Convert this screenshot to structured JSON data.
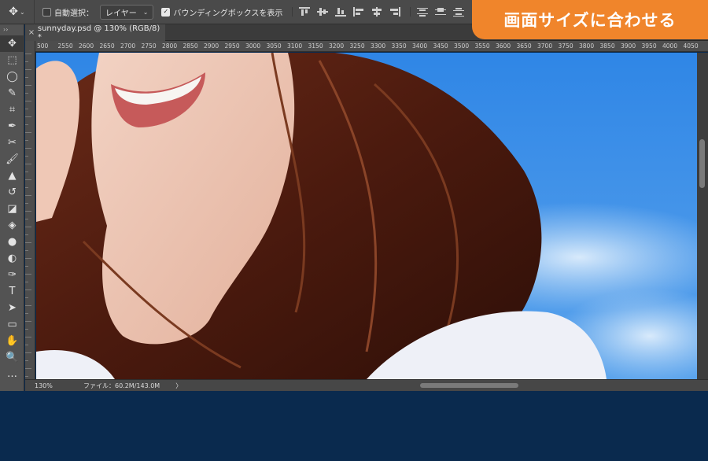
{
  "options_bar": {
    "auto_select_label": "自動選択：",
    "auto_select_value": "レイヤー",
    "bounding_box_label": "バウンディングボックスを表示"
  },
  "badge": {
    "text": "画面サイズに合わせる",
    "color": "#f0852b"
  },
  "document": {
    "tab_title": "sunnyday.psd @ 130% (RGB/8) *",
    "close_glyph": "×"
  },
  "ruler": {
    "top_marks": [
      "500",
      "2550",
      "2600",
      "2650",
      "2700",
      "2750",
      "2800",
      "2850",
      "2900",
      "2950",
      "3000",
      "3050",
      "3100",
      "3150",
      "3200",
      "3250",
      "3300",
      "3350",
      "3400",
      "3450",
      "3500",
      "3550",
      "3600",
      "3650",
      "3700",
      "3750",
      "3800",
      "3850",
      "3900",
      "3950",
      "4000",
      "4050"
    ]
  },
  "status_bar": {
    "zoom": "130%",
    "file_info": "ファイル：60.2M/143.0M",
    "arrow": "〉"
  },
  "tools": [
    {
      "name": "move-tool-icon",
      "glyph": "✥"
    },
    {
      "name": "marquee-tool-icon",
      "glyph": "⬚"
    },
    {
      "name": "lasso-tool-icon",
      "glyph": "◯"
    },
    {
      "name": "quick-select-tool-icon",
      "glyph": "✎"
    },
    {
      "name": "crop-tool-icon",
      "glyph": "⌗"
    },
    {
      "name": "eyedropper-tool-icon",
      "glyph": "✒"
    },
    {
      "name": "healing-brush-tool-icon",
      "glyph": "✂"
    },
    {
      "name": "brush-tool-icon",
      "glyph": "🖌"
    },
    {
      "name": "clone-stamp-tool-icon",
      "glyph": "▲"
    },
    {
      "name": "history-brush-tool-icon",
      "glyph": "↺"
    },
    {
      "name": "eraser-tool-icon",
      "glyph": "◪"
    },
    {
      "name": "paint-bucket-tool-icon",
      "glyph": "◈"
    },
    {
      "name": "blur-tool-icon",
      "glyph": "●"
    },
    {
      "name": "dodge-tool-icon",
      "glyph": "◐"
    },
    {
      "name": "pen-tool-icon",
      "glyph": "✑"
    },
    {
      "name": "type-tool-icon",
      "glyph": "T"
    },
    {
      "name": "path-select-tool-icon",
      "glyph": "➤"
    },
    {
      "name": "rectangle-tool-icon",
      "glyph": "▭"
    },
    {
      "name": "hand-tool-icon",
      "glyph": "✋"
    },
    {
      "name": "zoom-tool-icon",
      "glyph": "🔍"
    },
    {
      "name": "more-tools-icon",
      "glyph": "…"
    }
  ]
}
